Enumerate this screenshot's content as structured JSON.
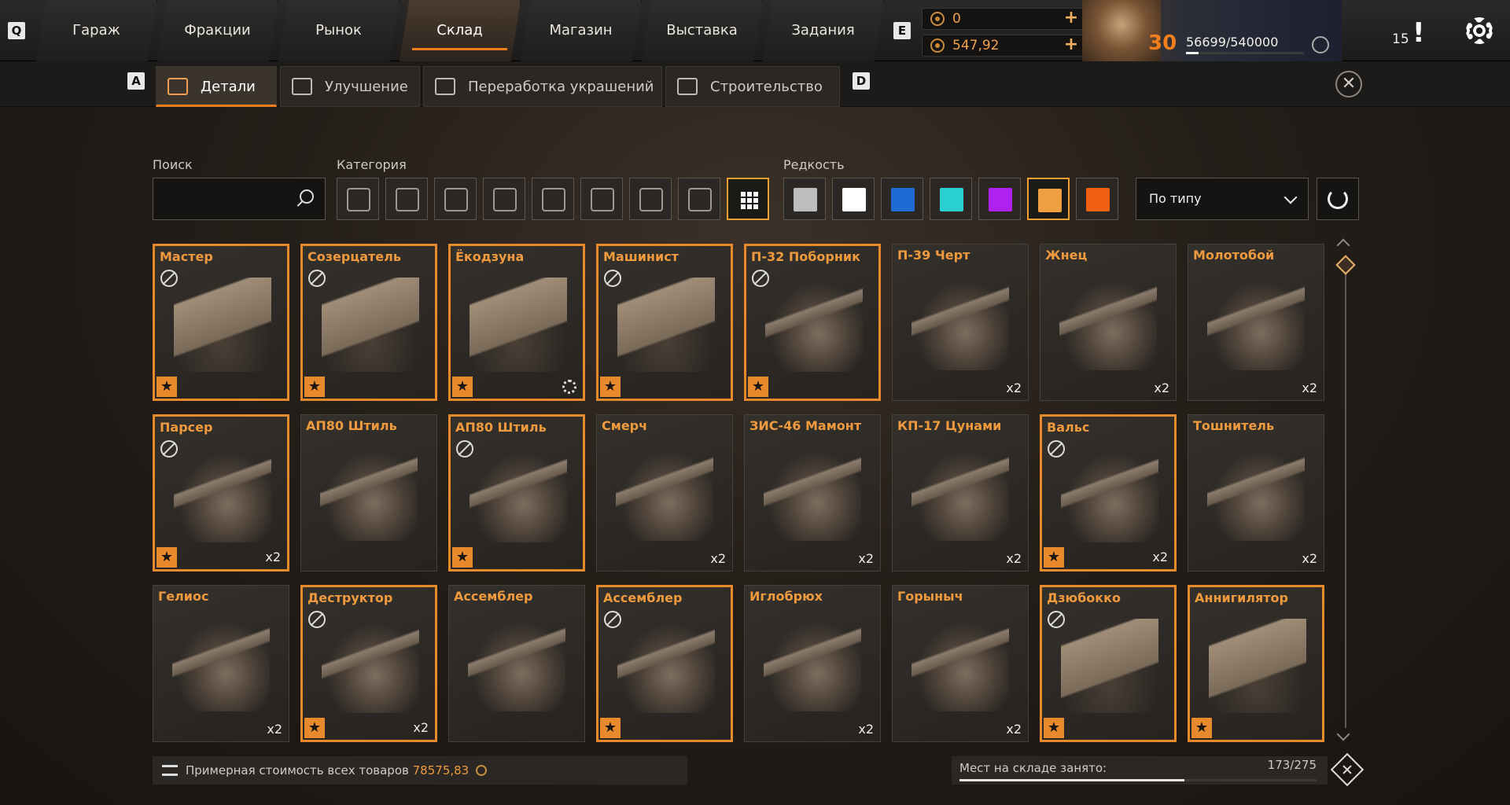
{
  "hotkeys": {
    "nav_prev": "Q",
    "nav_next": "E",
    "tab_prev": "A",
    "tab_next": "D"
  },
  "nav": {
    "items": [
      "Гараж",
      "Фракции",
      "Рынок",
      "Склад",
      "Магазин",
      "Выставка",
      "Задания"
    ],
    "active": "Склад"
  },
  "currency": {
    "primary": "0",
    "secondary": "547,92"
  },
  "profile": {
    "level": "30",
    "xp_text": "56699/540000",
    "xp_fraction": 0.105
  },
  "notifications": {
    "count": "15",
    "icon": "exclamation-icon"
  },
  "subtabs": [
    {
      "label": "Детали",
      "icon": "car-parts-icon",
      "active": true
    },
    {
      "label": "Улучшение",
      "icon": "upgrade-chevrons-icon",
      "active": false
    },
    {
      "label": "Переработка украшений",
      "icon": "recycle-icon",
      "active": false
    },
    {
      "label": "Строительство",
      "icon": "build-icon",
      "active": false
    }
  ],
  "filters": {
    "search_label": "Поиск",
    "search_value": "",
    "category_label": "Категория",
    "categories": [
      "cabin-icon",
      "chassis-icon",
      "hardware-icon",
      "wheel-icon",
      "frame-icon",
      "weapon-emblem-icon",
      "brush-icon",
      "module-icon",
      "all-grid-icon"
    ],
    "rarity_label": "Редкость",
    "rarity_colors": [
      "#bdbdbd",
      "#ffffff",
      "#1e6bd6",
      "#2ad0d0",
      "#b020f0",
      "#f0a040",
      "#f06010"
    ],
    "sort_value": "По типу"
  },
  "items": [
    {
      "name": "Мастер",
      "rare": true,
      "star": true,
      "noicon": true,
      "count": "",
      "kind": "cab"
    },
    {
      "name": "Созерцатель",
      "rare": true,
      "star": true,
      "noicon": true,
      "count": "",
      "kind": "cab"
    },
    {
      "name": "Ёкодзуна",
      "rare": true,
      "star": true,
      "noicon": false,
      "count": "",
      "kind": "cab",
      "gear": true
    },
    {
      "name": "Машинист",
      "rare": true,
      "star": true,
      "noicon": true,
      "count": "",
      "kind": "cab"
    },
    {
      "name": "П-32 Поборник",
      "rare": true,
      "star": true,
      "noicon": true,
      "count": "",
      "kind": "gun"
    },
    {
      "name": "П-39 Черт",
      "rare": false,
      "star": false,
      "noicon": false,
      "count": "x2",
      "kind": "gun"
    },
    {
      "name": "Жнец",
      "rare": false,
      "star": false,
      "noicon": false,
      "count": "x2",
      "kind": "gun"
    },
    {
      "name": "Молотобой",
      "rare": false,
      "star": false,
      "noicon": false,
      "count": "x2",
      "kind": "gun"
    },
    {
      "name": "Парсер",
      "rare": true,
      "star": true,
      "noicon": true,
      "count": "x2",
      "kind": "gun"
    },
    {
      "name": "АП80 Штиль",
      "rare": false,
      "star": false,
      "noicon": false,
      "count": "",
      "kind": "gun"
    },
    {
      "name": "АП80 Штиль",
      "rare": true,
      "star": true,
      "noicon": true,
      "count": "",
      "kind": "gun"
    },
    {
      "name": "Смерч",
      "rare": false,
      "star": false,
      "noicon": false,
      "count": "x2",
      "kind": "gun"
    },
    {
      "name": "ЗИС-46 Мамонт",
      "rare": false,
      "star": false,
      "noicon": false,
      "count": "x2",
      "kind": "gun"
    },
    {
      "name": "КП-17 Цунами",
      "rare": false,
      "star": false,
      "noicon": false,
      "count": "x2",
      "kind": "gun"
    },
    {
      "name": "Вальс",
      "rare": true,
      "star": true,
      "noicon": true,
      "count": "x2",
      "kind": "gun"
    },
    {
      "name": "Тошнитель",
      "rare": false,
      "star": false,
      "noicon": false,
      "count": "x2",
      "kind": "gun"
    },
    {
      "name": "Гелиос",
      "rare": false,
      "star": false,
      "noicon": false,
      "count": "x2",
      "kind": "gun"
    },
    {
      "name": "Деструктор",
      "rare": true,
      "star": true,
      "noicon": true,
      "count": "x2",
      "kind": "gun"
    },
    {
      "name": "Ассемблер",
      "rare": false,
      "star": false,
      "noicon": false,
      "count": "",
      "kind": "gun"
    },
    {
      "name": "Ассемблер",
      "rare": true,
      "star": true,
      "noicon": true,
      "count": "",
      "kind": "gun"
    },
    {
      "name": "Иглобрюх",
      "rare": false,
      "star": false,
      "noicon": false,
      "count": "x2",
      "kind": "gun"
    },
    {
      "name": "Горыныч",
      "rare": false,
      "star": false,
      "noicon": false,
      "count": "x2",
      "kind": "gun"
    },
    {
      "name": "Дзюбокко",
      "rare": true,
      "star": true,
      "noicon": true,
      "count": "",
      "kind": "cab"
    },
    {
      "name": "Аннигилятор",
      "rare": true,
      "star": true,
      "noicon": false,
      "count": "",
      "kind": "cab"
    }
  ],
  "footer": {
    "cost_label": "Примерная стоимость всех товаров",
    "cost_value": "78575,83",
    "storage_label": "Мест на складе занято:",
    "storage_value": "173/275",
    "storage_fraction": 0.629
  }
}
